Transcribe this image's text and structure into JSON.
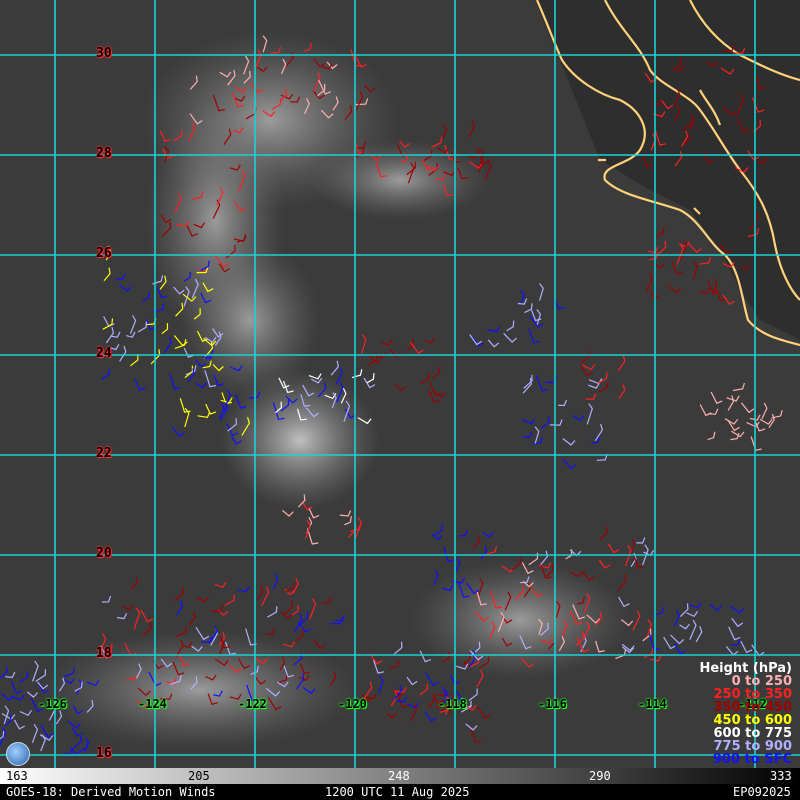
{
  "grid": {
    "lat_labels": [
      "30",
      "28",
      "26",
      "24",
      "22",
      "20",
      "18",
      "16"
    ],
    "lon_labels": [
      "-126",
      "-124",
      "-122",
      "-120",
      "-118",
      "-116",
      "-114",
      "-112"
    ]
  },
  "legend": {
    "title": "Height (hPa)",
    "entries": [
      {
        "label": "0 to 250",
        "color": "#ffb0b0"
      },
      {
        "label": "250 to 350",
        "color": "#ff2020"
      },
      {
        "label": "350 to 450",
        "color": "#a00000"
      },
      {
        "label": "450 to 600",
        "color": "#ffff00"
      },
      {
        "label": "600 to 775",
        "color": "#ffffff"
      },
      {
        "label": "775 to 900",
        "color": "#b0b0ff"
      },
      {
        "label": "900 to SFC",
        "color": "#1010ff"
      }
    ]
  },
  "colorbar": {
    "ticks": [
      "163",
      "205",
      "248",
      "290",
      "333"
    ]
  },
  "footer": {
    "left": "GOES-18: Derived Motion Winds",
    "center": "1200 UTC 11 Aug 2025",
    "right": "EP092025"
  },
  "colors": {
    "grid": "#19d3d8",
    "coastline": "#ffd27a"
  }
}
